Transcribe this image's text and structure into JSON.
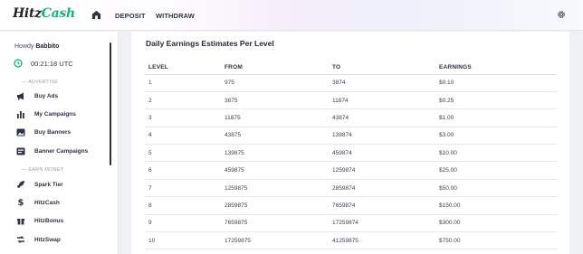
{
  "brand": {
    "logo_part1": "Hitz",
    "logo_part2": "Cash"
  },
  "nav": {
    "deposit": "DEPOSIT",
    "withdraw": "WITHDRAW"
  },
  "sidebar": {
    "howdy_prefix": "Howdy",
    "username": "Babbito",
    "time": "00:21:18 UTC",
    "section_advertise": "— ADVERTISE",
    "section_earn": "— EARN MONEY",
    "items": [
      {
        "label": "Buy Ads",
        "icon": "megaphone-icon"
      },
      {
        "label": "My Campaigns",
        "icon": "bar-chart-icon"
      },
      {
        "label": "Buy Banners",
        "icon": "image-icon"
      },
      {
        "label": "Banner Campaigns",
        "icon": "banner-icon"
      },
      {
        "label": "Spark Tier",
        "icon": "rocket-icon"
      },
      {
        "label": "HitzCash",
        "icon": "dollar-icon"
      },
      {
        "label": "HitzBonus",
        "icon": "gift-icon"
      },
      {
        "label": "HitzSwap",
        "icon": "swap-icon"
      }
    ]
  },
  "main": {
    "title": "Daily Earnings Estimates Per Level",
    "columns": [
      "LEVEL",
      "FROM",
      "TO",
      "EARNINGS"
    ],
    "rows": [
      [
        "1",
        "975",
        "3874",
        "$0.10"
      ],
      [
        "2",
        "3875",
        "11874",
        "$0.25"
      ],
      [
        "3",
        "11875",
        "43874",
        "$1.00"
      ],
      [
        "4",
        "43875",
        "139874",
        "$3.00"
      ],
      [
        "5",
        "139875",
        "459874",
        "$10.00"
      ],
      [
        "6",
        "459875",
        "1259874",
        "$25.00"
      ],
      [
        "7",
        "1259875",
        "2859874",
        "$50.00"
      ],
      [
        "8",
        "2859875",
        "7659874",
        "$150.00"
      ],
      [
        "9",
        "7659875",
        "17259874",
        "$300.00"
      ],
      [
        "10",
        "17259875",
        "41259875",
        "$750.00"
      ]
    ]
  },
  "colors": {
    "accent": "#18b07a",
    "text": "#2d3444"
  }
}
